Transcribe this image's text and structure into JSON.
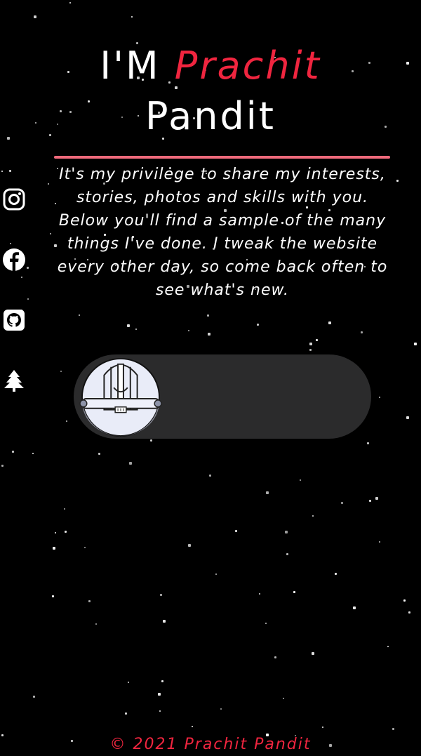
{
  "header": {
    "greeting": "I'M",
    "first_name": "Prachit",
    "last_name": "Pandit"
  },
  "intro": {
    "text": "It's my privilege to share my interests, stories, photos and skills with you. Below you'll find a sample of the many things I've done. I tweak the website every other day, so come back often to see what's new."
  },
  "social": [
    {
      "icon": "instagram-icon"
    },
    {
      "icon": "facebook-icon"
    },
    {
      "icon": "github-icon"
    },
    {
      "icon": "tree-icon"
    }
  ],
  "theme_toggle": {
    "state": "off",
    "knob_icon": "astronaut-helmet-icon"
  },
  "footer": {
    "copyright": "© 2021 Prachit Pandit"
  },
  "colors": {
    "background": "#000000",
    "accent": "#f0253f",
    "divider": "#f06a7c",
    "toggle_track": "#2b2b2c"
  }
}
